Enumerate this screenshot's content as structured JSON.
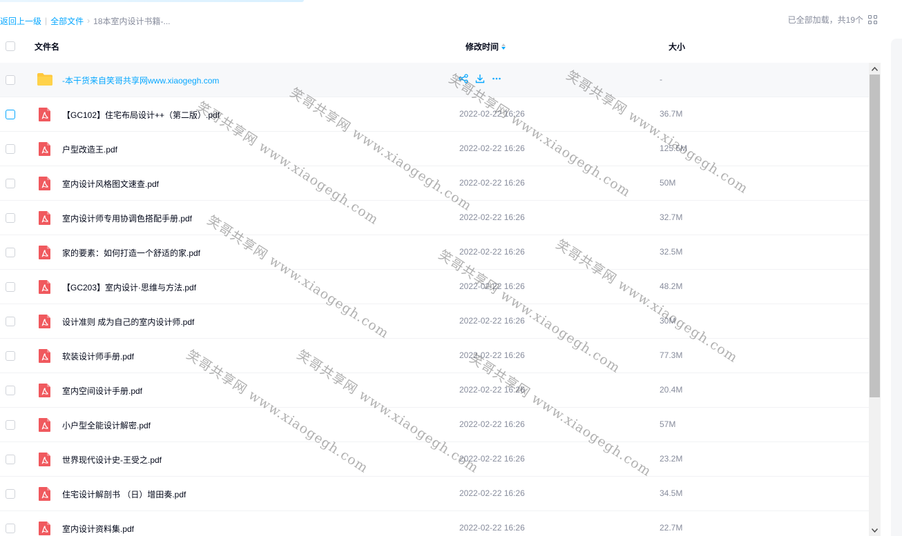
{
  "breadcrumb": {
    "back_label": "返回上一级",
    "root_label": "全部文件",
    "current_label": "18本室内设计书籍-..."
  },
  "status": {
    "load_text": "已全部加载，共19个",
    "view_toggle_icon": "grid-view-icon"
  },
  "table": {
    "columns": {
      "name": "文件名",
      "modified": "修改时间",
      "size": "大小"
    },
    "sort": {
      "column": "modified",
      "direction": "desc"
    }
  },
  "folder": {
    "name": "-本干货来自笑哥共享网www.xiaogegh.com",
    "size": "-",
    "actions": [
      "share-icon",
      "download-icon",
      "more-icon"
    ]
  },
  "files": [
    {
      "name": "【GC102】住宅布局设计++（第二版）.pdf",
      "time": "2022-02-22 16:26",
      "size": "36.7M"
    },
    {
      "name": "户型改造王.pdf",
      "time": "2022-02-22 16:26",
      "size": "125.5M"
    },
    {
      "name": "室内设计风格图文速查.pdf",
      "time": "2022-02-22 16:26",
      "size": "50M"
    },
    {
      "name": "室内设计师专用协调色搭配手册.pdf",
      "time": "2022-02-22 16:26",
      "size": "32.7M"
    },
    {
      "name": "家的要素：如何打造一个舒适的家.pdf",
      "time": "2022-02-22 16:26",
      "size": "32.5M"
    },
    {
      "name": "【GC203】室内设计·思维与方法.pdf",
      "time": "2022-02-22 16:26",
      "size": "48.2M"
    },
    {
      "name": "设计准则 成为自己的室内设计师.pdf",
      "time": "2022-02-22 16:26",
      "size": "30M"
    },
    {
      "name": "软装设计师手册.pdf",
      "time": "2022-02-22 16:26",
      "size": "77.3M"
    },
    {
      "name": "室内空间设计手册.pdf",
      "time": "2022-02-22 16:26",
      "size": "20.4M"
    },
    {
      "name": "小户型全能设计解密.pdf",
      "time": "2022-02-22 16:26",
      "size": "57M"
    },
    {
      "name": "世界现代设计史-王受之.pdf",
      "time": "2022-02-22 16:26",
      "size": "23.2M"
    },
    {
      "name": "住宅设计解剖书 （日）增田奏.pdf",
      "time": "2022-02-22 16:26",
      "size": "34.5M"
    },
    {
      "name": "室内设计资料集.pdf",
      "time": "2022-02-22 16:26",
      "size": "22.7M"
    }
  ],
  "watermark_text": "笑哥共享网 www.xiaogegh.com",
  "colors": {
    "accent": "#06a7ff",
    "pdf_icon": "#f0595e",
    "folder_icon": "#ffc83d",
    "muted_text": "#878c9c"
  }
}
